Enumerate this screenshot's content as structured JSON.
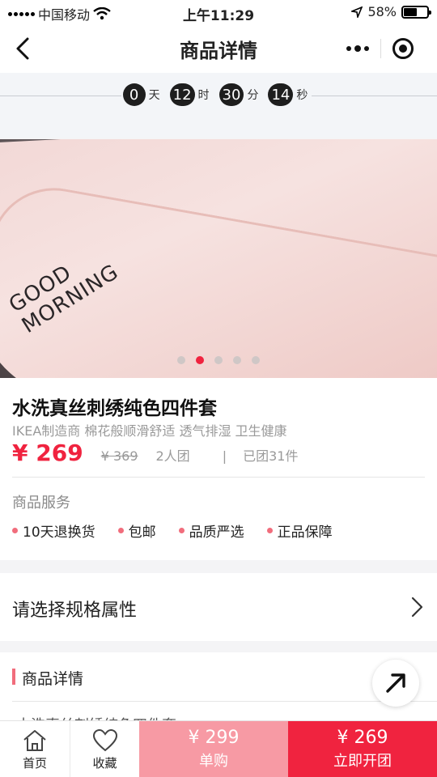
{
  "status": {
    "carrier": "中国移动",
    "time": "上午11:29",
    "battery": "58%",
    "battery_level": 0.58
  },
  "nav": {
    "title": "商品详情"
  },
  "countdown": {
    "days": "0",
    "days_unit": "天",
    "hours": "12",
    "hours_unit": "时",
    "minutes": "30",
    "minutes_unit": "分",
    "seconds": "14",
    "seconds_unit": "秒"
  },
  "hero": {
    "print_text_1": "GOOD",
    "print_text_2": "MORNING",
    "slide_count": 5,
    "active_slide": 2
  },
  "product": {
    "name": "水洗真丝刺绣纯色四件套",
    "desc": "IKEA制造商 棉花般顺滑舒适 透气排湿 卫生健康",
    "price": "¥ 269",
    "original_price": "¥ 369",
    "team_size": "2人团",
    "separator": "|",
    "sold": "已团31件"
  },
  "service": {
    "title": "商品服务",
    "items": [
      "10天退换货",
      "包邮",
      "品质严选",
      "正品保障"
    ]
  },
  "spec": {
    "label": "请选择规格属性"
  },
  "detail": {
    "title": "商品详情",
    "preview": "水洗真丝刺绣纯色四件套"
  },
  "bottom": {
    "home_label": "首页",
    "fav_label": "收藏",
    "single_price": "¥ 299",
    "single_label": "单购",
    "group_price": "¥ 269",
    "group_label": "立即开团"
  },
  "colors": {
    "accent": "#f0233f",
    "soft_accent": "#f79aa4",
    "dot": "#f16d7c"
  }
}
